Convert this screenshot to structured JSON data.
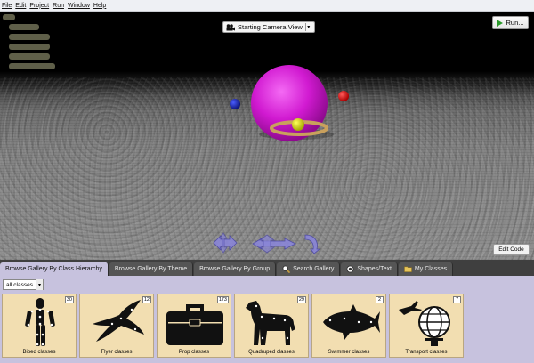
{
  "menu": {
    "items": [
      "File",
      "Edit",
      "Project",
      "Run",
      "Window",
      "Help"
    ]
  },
  "scene": {
    "camera_view": "Starting Camera View",
    "run_label": "Run...",
    "edit_code_label": "Edit Code"
  },
  "tabs": [
    {
      "label": "Browse Gallery By Class Hierarchy"
    },
    {
      "label": "Browse Gallery By Theme"
    },
    {
      "label": "Browse Gallery By Group"
    },
    {
      "label": "Search Gallery"
    },
    {
      "label": "Shapes/Text"
    },
    {
      "label": "My Classes"
    }
  ],
  "gallery": {
    "filter": "all classes",
    "tiles": [
      {
        "label": "Biped classes",
        "count": "30"
      },
      {
        "label": "Flyer classes",
        "count": "12"
      },
      {
        "label": "Prop classes",
        "count": "173"
      },
      {
        "label": "Quadruped classes",
        "count": "29"
      },
      {
        "label": "Swimmer classes",
        "count": "2"
      },
      {
        "label": "Transport classes",
        "count": "7"
      }
    ]
  },
  "colors": {
    "big_sphere": "#d11ad1",
    "red_sphere": "#cc1111",
    "blue_sphere": "#1a26b8",
    "yellow_sphere": "#d8d800",
    "torus": "#c9a05c",
    "gallery_bg": "#c7c2de",
    "tile_bg": "#f2deb1"
  }
}
